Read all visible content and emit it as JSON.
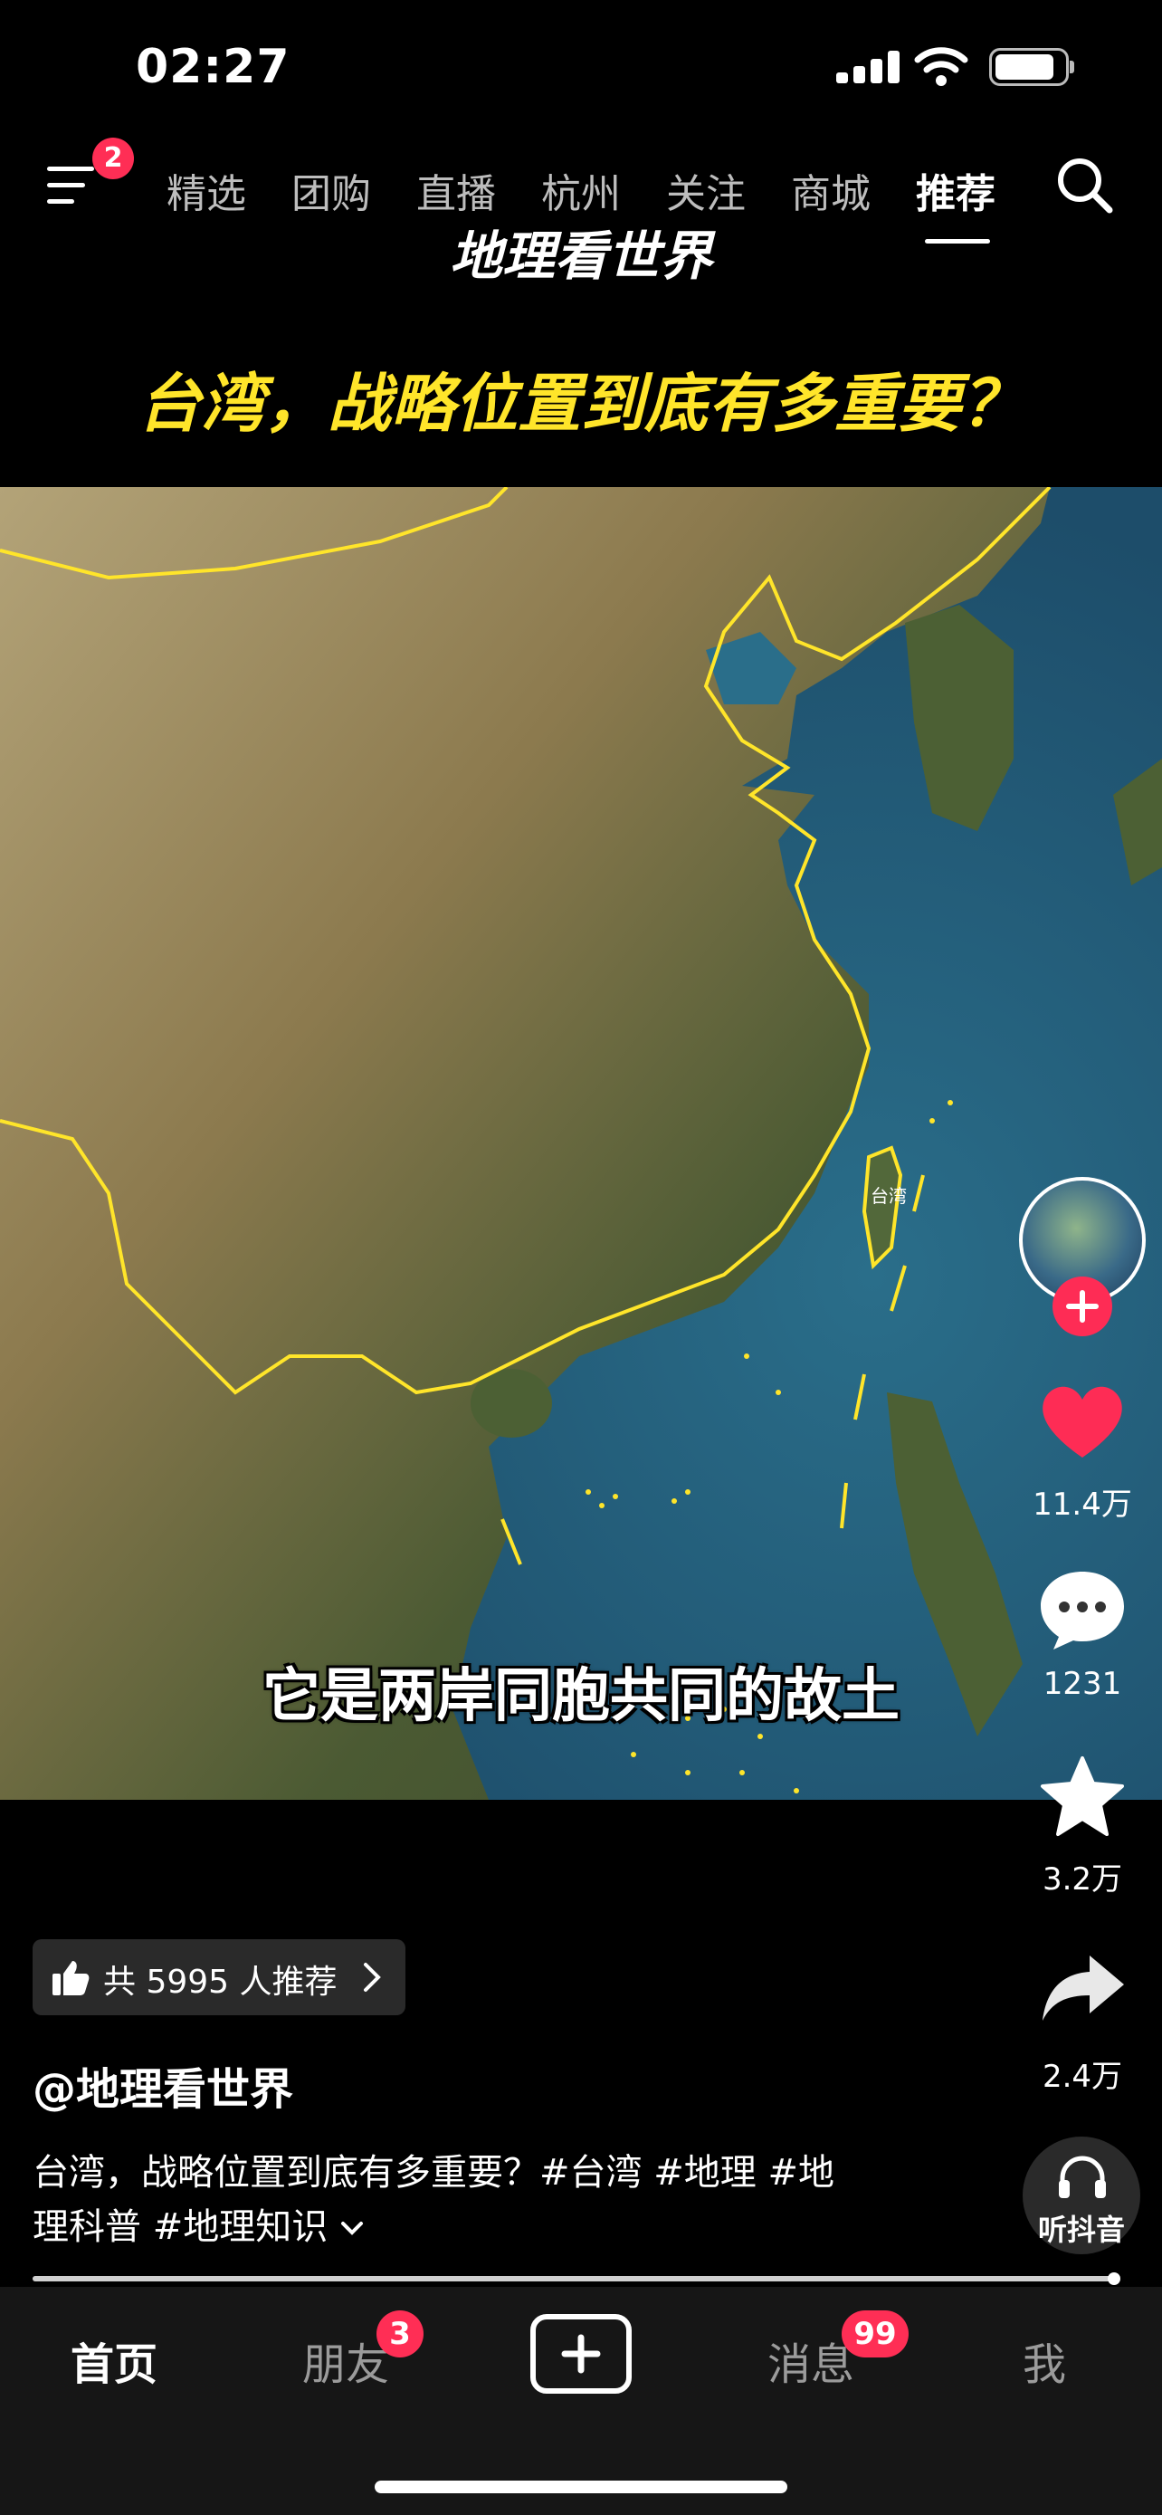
{
  "status_bar": {
    "time": "02:27"
  },
  "top_nav": {
    "menu_badge": "2",
    "tabs": [
      {
        "label": "精选"
      },
      {
        "label": "团购"
      },
      {
        "label": "直播"
      },
      {
        "label": "杭州"
      },
      {
        "label": "关注"
      },
      {
        "label": "商城"
      },
      {
        "label": "推荐"
      }
    ]
  },
  "video": {
    "channel_watermark": "地理看世界",
    "headline": "台湾，战略位置到底有多重要？",
    "map_label": "台湾",
    "subtitle": "它是两岸同胞共同的故土"
  },
  "actions": {
    "likes": "11.4万",
    "comments": "1231",
    "favorites": "3.2万",
    "shares": "2.4万",
    "listen_label": "听抖音"
  },
  "info": {
    "recommend": "共 5995 人推荐",
    "author": "@地理看世界",
    "description_line1": "台湾，战略位置到底有多重要？#台湾 #地理 #地",
    "description_line2": "理科普 #地理知识"
  },
  "bottom_nav": {
    "home": "首页",
    "friends": "朋友",
    "friends_badge": "3",
    "messages": "消息",
    "messages_badge": "99",
    "me": "我"
  },
  "colors": {
    "accent_yellow": "#ffe52a",
    "like_red": "#fe2c55",
    "badge_red": "#ff2e55"
  }
}
